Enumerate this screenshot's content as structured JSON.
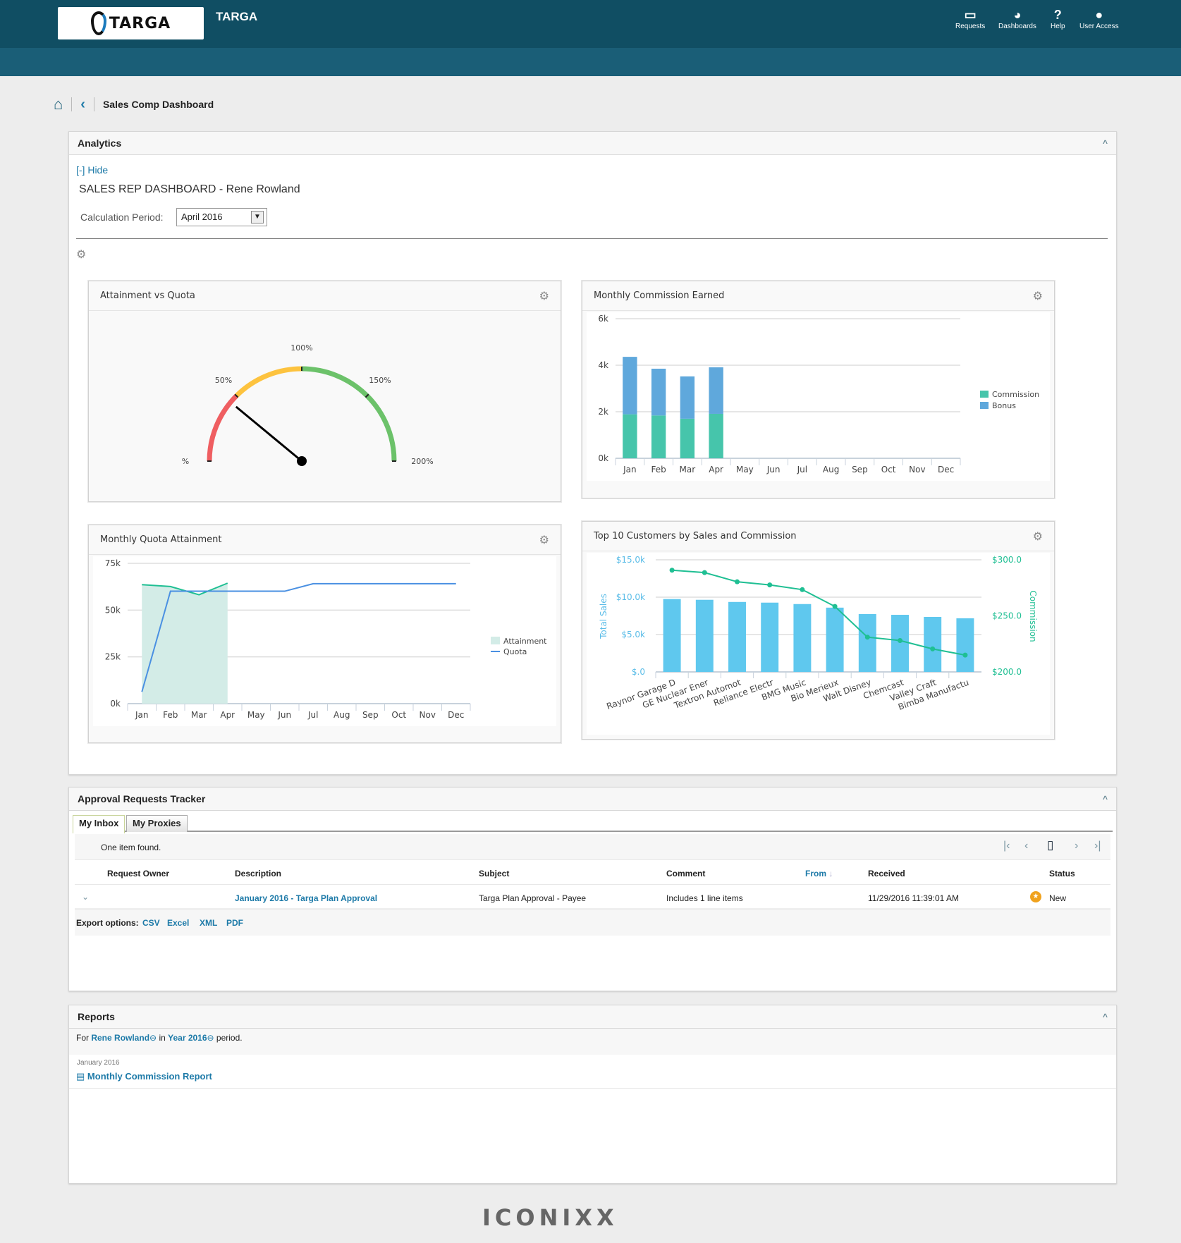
{
  "header": {
    "logo_text": "TARGA",
    "app_title": "TARGA",
    "nav": [
      {
        "label": "Requests",
        "icon": "inbox-icon"
      },
      {
        "label": "Dashboards",
        "icon": "dashboard-gauge-icon"
      },
      {
        "label": "Help",
        "icon": "question-icon"
      },
      {
        "label": "User Access",
        "icon": "user-icon"
      }
    ]
  },
  "breadcrumb": {
    "title": "Sales Comp Dashboard"
  },
  "analytics": {
    "title": "Analytics",
    "hide_label": "[-] Hide",
    "dashboard_title": "SALES REP DASHBOARD - Rene Rowland",
    "period_label": "Calculation Period:",
    "period_value": "April 2016"
  },
  "colors": {
    "header": "#104e63",
    "link": "#1d7aa8",
    "commission": "#46c5ab",
    "bonus": "#5fa8dc",
    "sales_bar": "#5fc8ee",
    "commission_line": "#1fbf93",
    "gauge_red": "#ef5e61",
    "gauge_yellow": "#fdc33f",
    "gauge_green": "#6cc26a"
  },
  "chart_data": [
    {
      "type": "gauge",
      "title": "Attainment vs Quota",
      "value": 44,
      "range": [
        0,
        200
      ],
      "tick_labels": [
        "%",
        "50%",
        "100%",
        "150%",
        "200%"
      ],
      "bands": [
        {
          "from": 0,
          "to": 50,
          "color": "red"
        },
        {
          "from": 50,
          "to": 100,
          "color": "yellow"
        },
        {
          "from": 100,
          "to": 200,
          "color": "green"
        }
      ]
    },
    {
      "type": "bar",
      "stacked": true,
      "title": "Monthly Commission Earned",
      "categories": [
        "Jan",
        "Feb",
        "Mar",
        "Apr",
        "May",
        "Jun",
        "Jul",
        "Aug",
        "Sep",
        "Oct",
        "Nov",
        "Dec"
      ],
      "ylim": [
        0,
        6000
      ],
      "yticks": [
        "0k",
        "2k",
        "4k",
        "6k"
      ],
      "legend": "right",
      "grid": true,
      "series": [
        {
          "name": "Commission",
          "values": [
            1890,
            1840,
            1700,
            1910,
            null,
            null,
            null,
            null,
            null,
            null,
            null,
            null
          ]
        },
        {
          "name": "Bonus",
          "values": [
            2470,
            2010,
            1820,
            2000,
            null,
            null,
            null,
            null,
            null,
            null,
            null,
            null
          ]
        }
      ]
    },
    {
      "type": "area",
      "title": "Monthly Quota Attainment",
      "categories": [
        "Jan",
        "Feb",
        "Mar",
        "Apr",
        "May",
        "Jun",
        "Jul",
        "Aug",
        "Sep",
        "Oct",
        "Nov",
        "Dec"
      ],
      "ylim": [
        0,
        75000
      ],
      "yticks": [
        "0k",
        "25k",
        "50k",
        "75k"
      ],
      "legend": "right",
      "grid": true,
      "series": [
        {
          "name": "Attainment",
          "values": [
            63600,
            62600,
            58200,
            64400,
            null,
            null,
            null,
            null,
            null,
            null,
            null,
            null
          ]
        },
        {
          "name": "Quota",
          "values": [
            6300,
            60100,
            60100,
            60100,
            60100,
            60100,
            64100,
            64100,
            64100,
            64100,
            64100,
            64100
          ]
        }
      ]
    },
    {
      "type": "bar",
      "title": "Top 10 Customers by Sales and Commission",
      "categories": [
        "Raynor Garage D",
        "GE Nuclear Ener",
        "Textron Automot",
        "Reliance Electr",
        "BMG Music",
        "Bio Merieux",
        "Walt Disney",
        "Chemcast",
        "Valley Craft",
        "Bimba Manufactu"
      ],
      "ylabel": "Total Sales",
      "y2label": "Commission",
      "ylim": [
        0,
        15000
      ],
      "y2lim": [
        200,
        300
      ],
      "yticks": [
        "$.0",
        "$5.0k",
        "$10.0k",
        "$15.0k"
      ],
      "y2ticks": [
        "$200.0",
        "$250.0",
        "$300.0"
      ],
      "grid": true,
      "series": [
        {
          "name": "Total Sales",
          "type": "bar",
          "values": [
            9750,
            9650,
            9360,
            9270,
            9080,
            8600,
            7740,
            7640,
            7360,
            7170
          ]
        },
        {
          "name": "Commission",
          "type": "line",
          "axis": "right",
          "values": [
            290.7,
            288.6,
            280.4,
            277.6,
            273.4,
            258.4,
            231,
            228,
            220.5,
            215
          ]
        }
      ]
    }
  ],
  "approval": {
    "title": "Approval Requests Tracker",
    "tabs": [
      "My Inbox",
      "My Proxies"
    ],
    "found": "One item found.",
    "columns": [
      "Request Owner",
      "Description",
      "Subject",
      "Comment",
      "From",
      "Received",
      "Status"
    ],
    "rows": [
      {
        "owner": "",
        "description": "January 2016 - Targa Plan Approval",
        "subject": "Targa Plan Approval - Payee",
        "comment": "Includes 1 line items",
        "from": "",
        "received": "11/29/2016 11:39:01 AM",
        "status": "New"
      }
    ],
    "export_label": "Export options:",
    "export": [
      "CSV",
      "Excel",
      "XML",
      "PDF"
    ]
  },
  "reports": {
    "title": "Reports",
    "for": "For",
    "user": "Rene Rowland",
    "in": "in",
    "period": "Year 2016",
    "suffix": "period.",
    "group": "January 2016",
    "item": "Monthly Commission Report"
  },
  "footer": {
    "brand": "ICONIXX"
  }
}
